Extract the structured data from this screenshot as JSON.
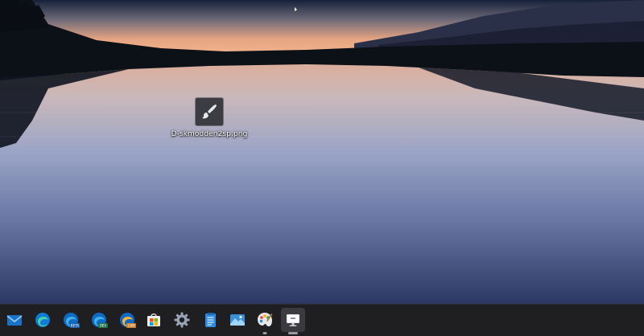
{
  "desktop": {
    "icons": [
      {
        "name": "paint-icon",
        "label": "D-skmodden2sp.png"
      }
    ]
  },
  "taskbar": {
    "apps": [
      {
        "icon": "mail-icon",
        "state": "normal"
      },
      {
        "icon": "edge-icon",
        "state": "normal"
      },
      {
        "icon": "edge-beta-icon",
        "badge": "BETA",
        "state": "normal"
      },
      {
        "icon": "edge-dev-icon",
        "badge": "DEV",
        "state": "normal"
      },
      {
        "icon": "edge-canary-icon",
        "badge": "CAN",
        "state": "normal"
      },
      {
        "icon": "store-icon",
        "state": "normal"
      },
      {
        "icon": "settings-gear-icon",
        "state": "normal"
      },
      {
        "icon": "notepad-icon",
        "state": "normal"
      },
      {
        "icon": "photos-icon",
        "state": "normal"
      },
      {
        "icon": "paint-icon",
        "state": "running"
      },
      {
        "icon": "remote-desktop-icon",
        "state": "focused"
      }
    ]
  },
  "colors": {
    "taskbar_bg": "#1f1f22",
    "accent_blue": "#1e88e5",
    "sky_top": "#0f1c33",
    "sunset": "#f0a77a",
    "water": "#5b6b92"
  }
}
